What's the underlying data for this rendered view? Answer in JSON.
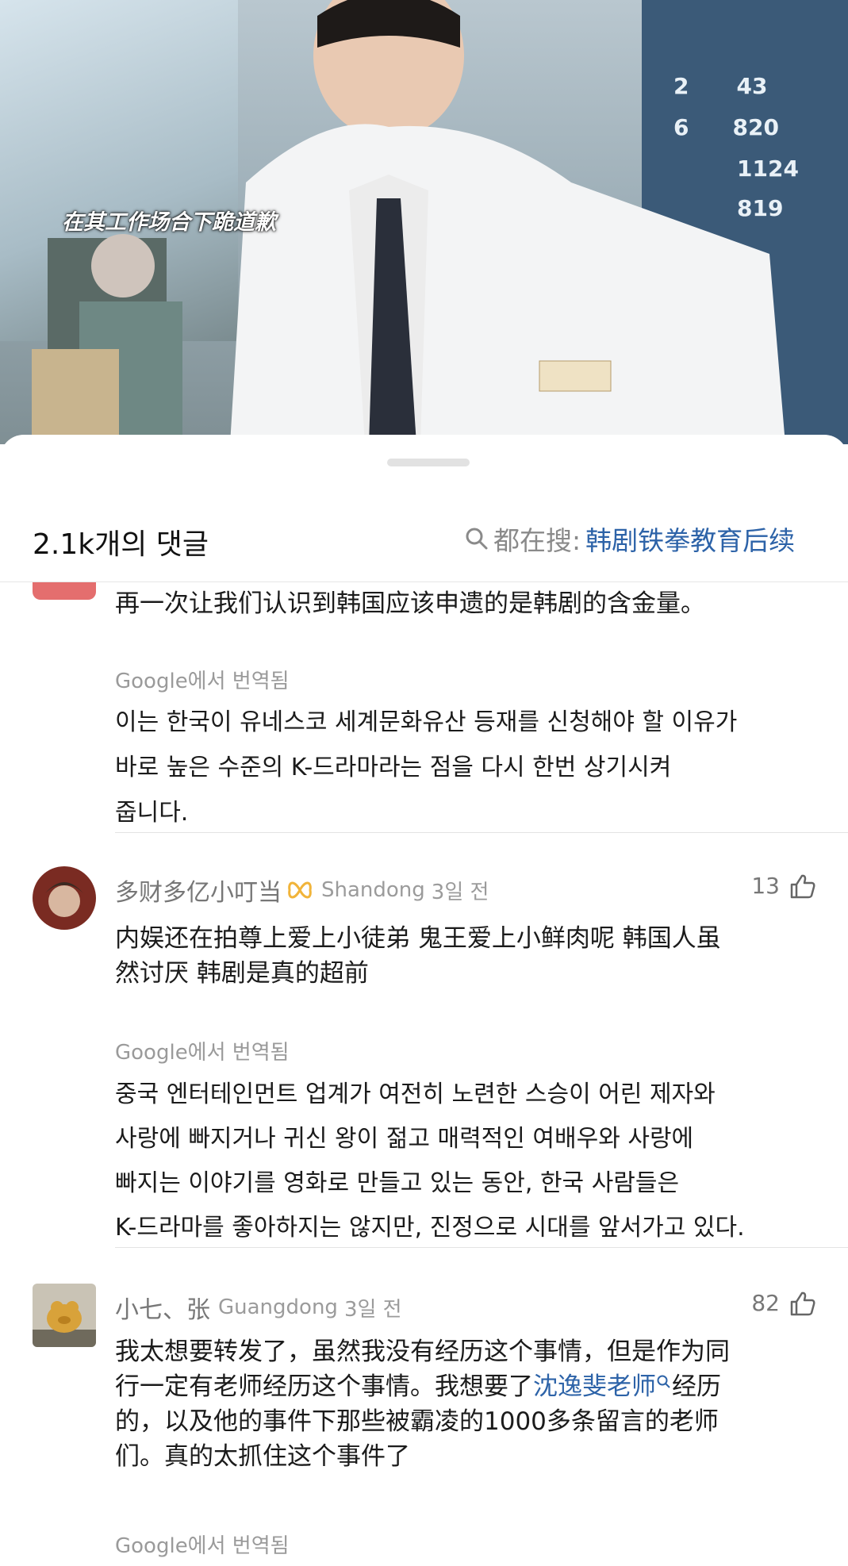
{
  "video": {
    "subtitle": "在其工作场合下跪道歉",
    "board_numbers": [
      "2",
      "43",
      "6",
      "820",
      "1124",
      "819"
    ]
  },
  "sheet": {
    "title": "2.1k개의 댓글",
    "search_prefix": "都在搜:",
    "search_term": "韩剧铁拳教育后续"
  },
  "comments": [
    {
      "text": "再一次让我们认识到韩国应该申遗的是韩剧的含金量。",
      "translated_label": "Google에서 번역됨",
      "translation_lines": [
        "이는 한국이 유네스코 세계문화유산 등재를 신청해야 할 이유가",
        "바로 높은 수준의 K-드라마라는 점을 다시 한번 상기시켜",
        "줍니다."
      ]
    },
    {
      "name": "多财多亿小叮当",
      "location": "Shandong",
      "time": "3일 전",
      "likes": "13",
      "text_lines": [
        "内娱还在拍尊上爱上小徒弟  鬼王爱上小鲜肉呢  韩国人虽",
        "然讨厌 韩剧是真的超前"
      ],
      "translated_label": "Google에서 번역됨",
      "translation_lines": [
        "중국 엔터테인먼트 업계가 여전히 노련한 스승이 어린 제자와",
        "사랑에 빠지거나 귀신 왕이 젊고 매력적인 여배우와 사랑에",
        "빠지는 이야기를 영화로 만들고 있는 동안, 한국 사람들은",
        "K-드라마를 좋아하지는 않지만, 진정으로 시대를 앞서가고 있다."
      ]
    },
    {
      "name": "小七、张",
      "location": "Guangdong",
      "time": "3일 전",
      "likes": "82",
      "text_line1": "我太想要转发了，虽然我没有经历这个事情，但是作为同",
      "text_line2_a": "行一定有老师经历这个事情。我想要了",
      "text_line2_link": "沈逸斐老师",
      "text_line2_b": "经历",
      "text_line3": "的，以及他的事件下那些被霸凌的1000多条留言的老师",
      "text_line4": "们。真的太抓住这个事件了",
      "translated_label": "Google에서 번역됨"
    }
  ],
  "colors": {
    "link": "#2d63a8",
    "muted": "#9a9a9a",
    "text": "#1b1b1b"
  }
}
